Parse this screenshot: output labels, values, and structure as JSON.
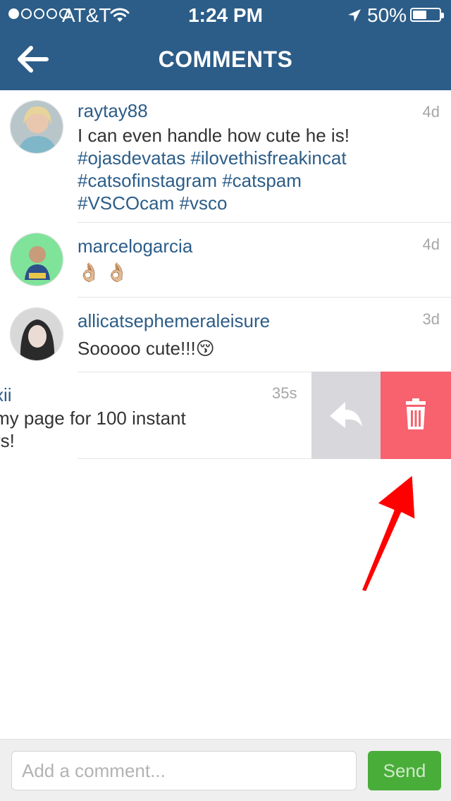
{
  "status_bar": {
    "carrier": "AT&T",
    "time": "1:24 PM",
    "battery_percent": "50%",
    "signal_bars_filled": 1,
    "signal_bars_total": 5,
    "battery_level": 0.5
  },
  "nav": {
    "title": "COMMENTS",
    "back_icon": "back-arrow-icon"
  },
  "comments": [
    {
      "username": "raytay88",
      "time": "4d",
      "text": "I can even handle how cute he is!",
      "hashtags_line1": "#ojasdevatas #ilovethisfreakincat",
      "hashtags_line2": "#catsofinstagram #catspam",
      "hashtags_line3": "#VSCOcam #vsco"
    },
    {
      "username": "marcelogarcia",
      "time": "4d",
      "text": "👌🏼 👌🏼"
    },
    {
      "username": "allicatsephemeraleisure",
      "time": "3d",
      "text": "Sooooo cute!!!😚"
    },
    {
      "username_partial": "xii",
      "time": "35s",
      "text_line1": "my page for 100 instant",
      "text_line2": "rs!"
    }
  ],
  "swipe_actions": {
    "reply_icon": "reply-icon",
    "delete_icon": "trash-icon"
  },
  "composer": {
    "placeholder": "Add a comment...",
    "send_label": "Send"
  },
  "colors": {
    "nav_bg": "#2c5d88",
    "link": "#2c5d88",
    "delete": "#f8616e",
    "reply": "#d8d8dc",
    "send": "#49ad39",
    "annotation_arrow": "#ff0000"
  }
}
